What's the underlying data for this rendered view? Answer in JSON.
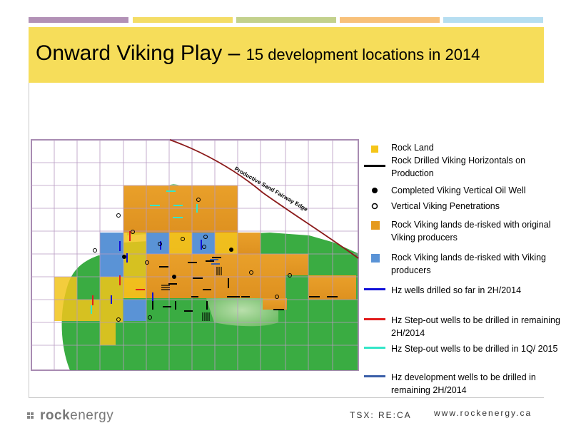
{
  "header": {
    "title_main": "Onward Viking Play – ",
    "title_sub": "15 development locations in 2014"
  },
  "map": {
    "edge_label": "Productive Sand Fairway Edge"
  },
  "legend": [
    {
      "icon": "rock-land-icon",
      "color": "#f5c518",
      "label": "Rock Land"
    },
    {
      "icon": "horizontal-line-icon",
      "color": "#000000",
      "label": "Rock Drilled Viking Horizontals on Production"
    },
    {
      "icon": "filled-dot-icon",
      "color": "#000000",
      "label": "Completed Viking Vertical Oil Well"
    },
    {
      "icon": "open-circle-icon",
      "color": "#000000",
      "label": "Vertical Viking Penetrations"
    },
    {
      "icon": "orange-square-icon",
      "color": "#e59a1e",
      "label": "Rock Viking lands de-risked with original Viking producers"
    },
    {
      "icon": "blue-square-icon",
      "color": "#5a93d6",
      "label": "Rock Viking lands de-risked with Viking producers"
    },
    {
      "icon": "blue-line-icon",
      "color": "#1010d8",
      "label": "Hz wells drilled so far in 2H/2014"
    },
    {
      "icon": "red-line-icon",
      "color": "#e11b1b",
      "label": "Hz Step-out wells to be drilled in remaining 2H/2014"
    },
    {
      "icon": "cyan-line-icon",
      "color": "#34e6c8",
      "label": "Hz Step-out wells to be drilled  in 1Q/ 2015"
    },
    {
      "icon": "navy-line-icon",
      "color": "#3a5ea8",
      "label": "Hz development wells to be drilled in remaining 2H/2014"
    }
  ],
  "footer": {
    "logo_rock": "rock",
    "logo_energy": "energy",
    "ticker": "TSX: RE:CA",
    "website": "www.rockenergy.ca"
  }
}
